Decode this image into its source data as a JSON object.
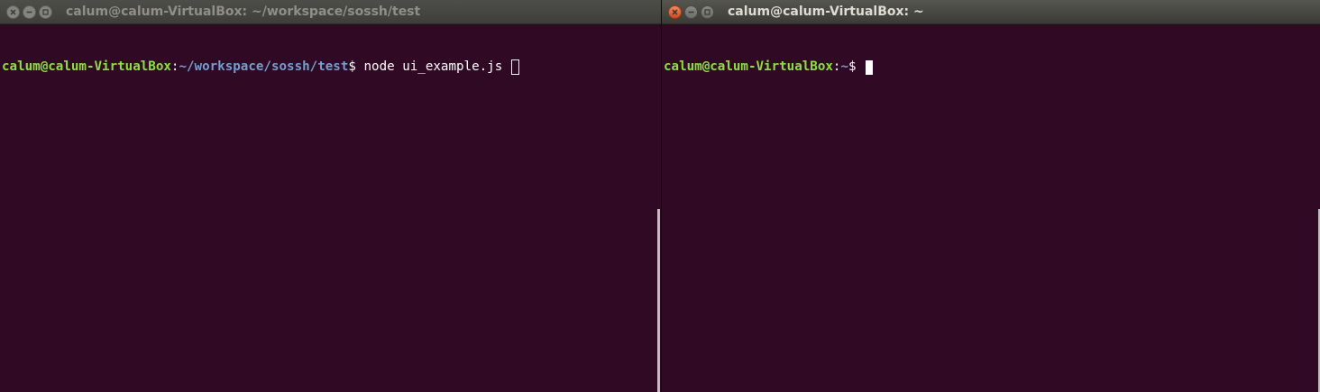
{
  "windows": {
    "left": {
      "title": "calum@calum-VirtualBox: ~/workspace/sossh/test",
      "focused": false,
      "prompt_user": "calum@calum-VirtualBox",
      "prompt_colon": ":",
      "prompt_path": "~/workspace/sossh/test",
      "prompt_symbol": "$ ",
      "command": "node ui_example.js "
    },
    "right": {
      "title": "calum@calum-VirtualBox: ~",
      "focused": true,
      "prompt_user": "calum@calum-VirtualBox",
      "prompt_colon": ":",
      "prompt_path": "~",
      "prompt_symbol": "$ ",
      "command": ""
    }
  },
  "icons": {
    "close": "close-icon",
    "minimize": "minimize-icon",
    "maximize": "maximize-icon"
  },
  "colors": {
    "terminal_bg": "#300a24",
    "prompt_user": "#8ae234",
    "prompt_path": "#729fcf",
    "close_active": "#dd4814",
    "titlebar": "#3c3b37"
  }
}
